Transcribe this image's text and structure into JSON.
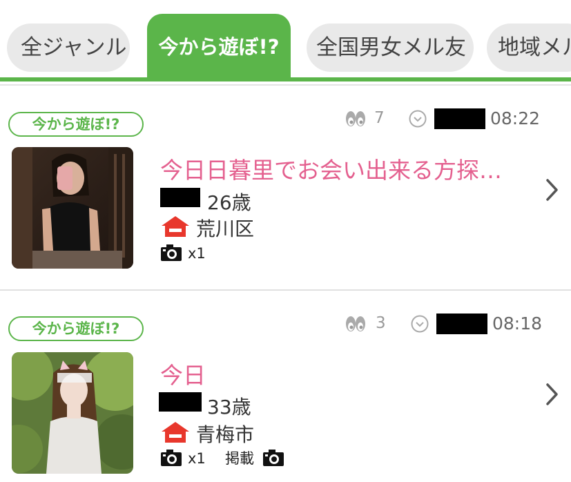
{
  "tabs": [
    {
      "label": "全ジャンル",
      "active": false
    },
    {
      "label": "今から遊ぼ!?",
      "active": true
    },
    {
      "label": "全国男女メル友",
      "active": false
    },
    {
      "label": "地域メル友",
      "active": false
    }
  ],
  "colors": {
    "accent_green": "#5bb54a",
    "title_pink": "#e4608f",
    "house_red": "#e8372c"
  },
  "posts": [
    {
      "genre": "今から遊ぼ!?",
      "views": "7",
      "time": "08:22",
      "title": "今日日暮里でお会い出来る方探…",
      "age": "26歳",
      "location": "荒川区",
      "photo_count": "x1",
      "icons": [
        "eyes-icon",
        "clock-icon",
        "house-icon",
        "camera-icon",
        "chevron-right-icon"
      ]
    },
    {
      "genre": "今から遊ぼ!?",
      "views": "3",
      "time": "08:18",
      "title": "今日",
      "age": "33歳",
      "location": "青梅市",
      "photo_count": "x1",
      "posted_label": "掲載",
      "icons": [
        "eyes-icon",
        "clock-icon",
        "house-icon",
        "camera-icon",
        "chevron-right-icon"
      ]
    }
  ]
}
